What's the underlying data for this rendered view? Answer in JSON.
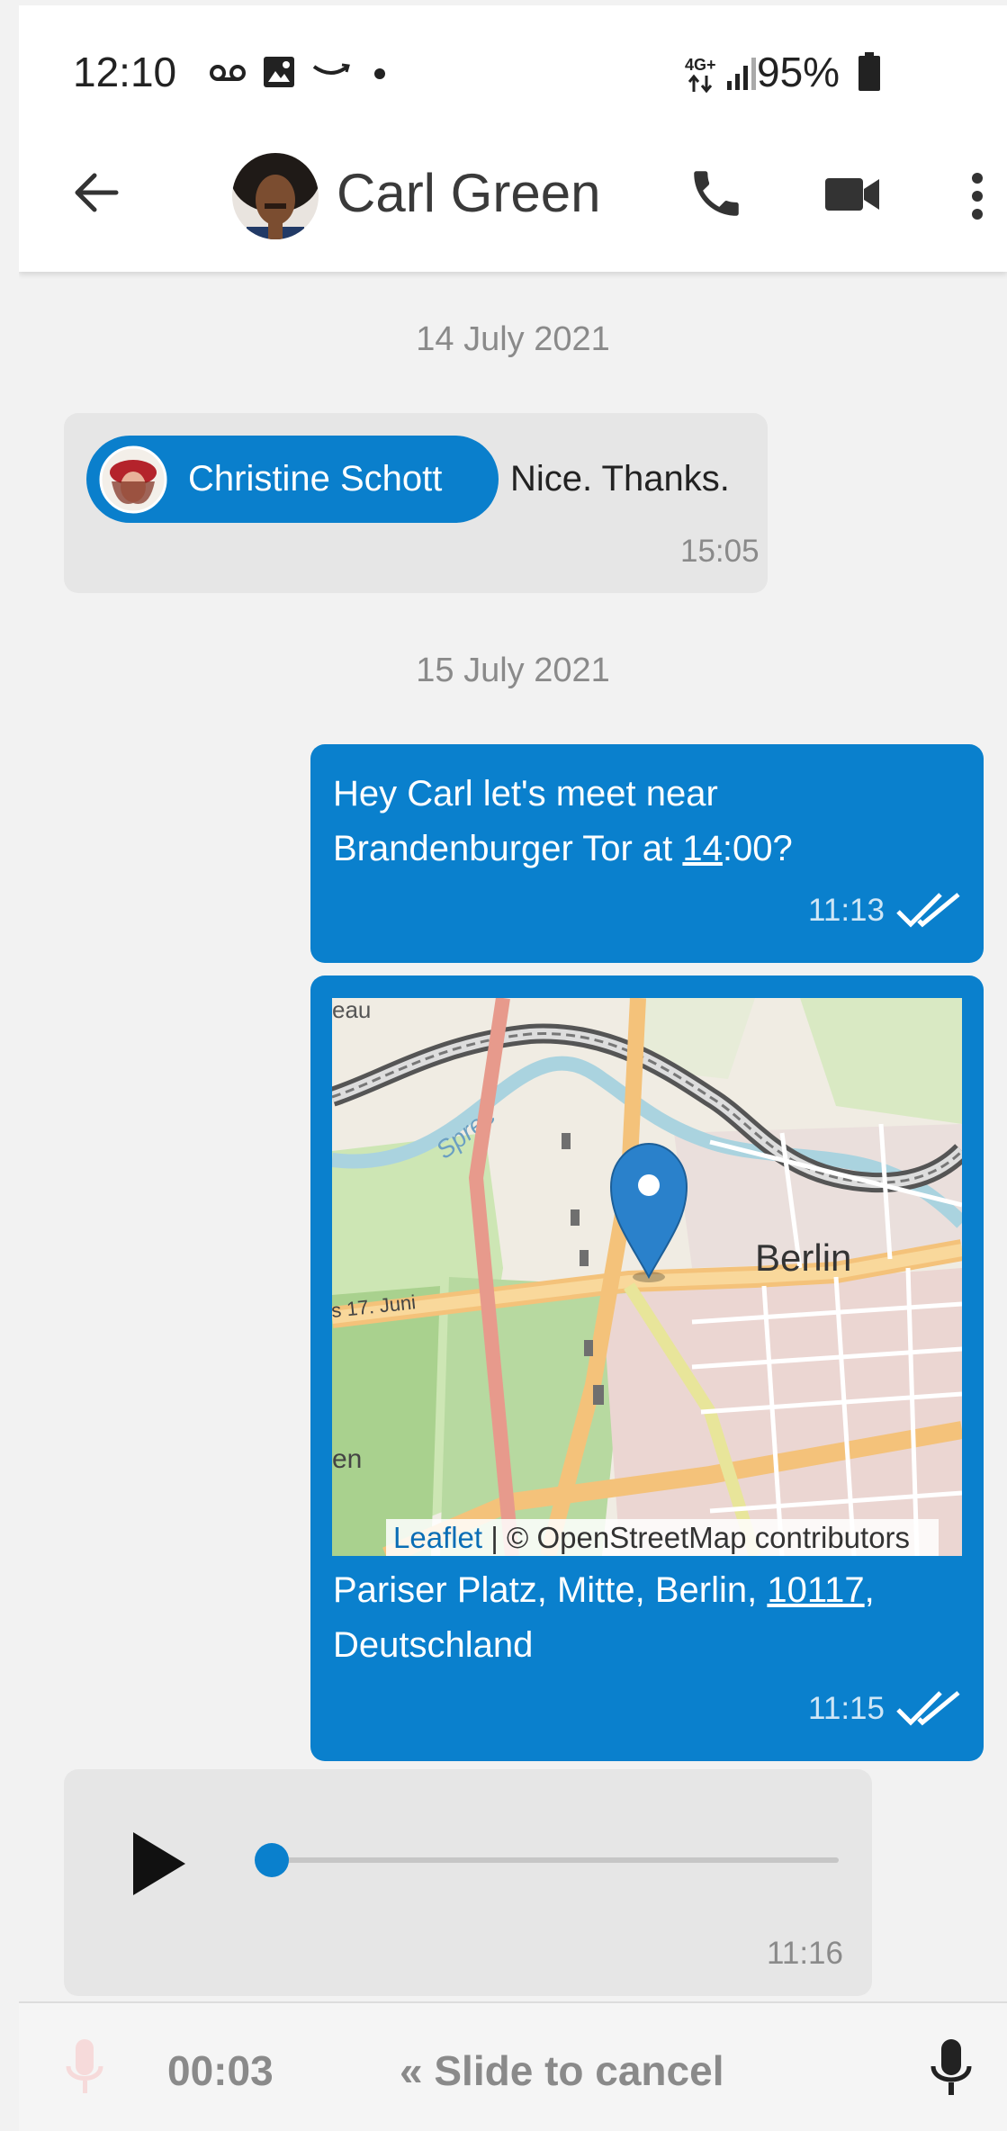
{
  "status_bar": {
    "time": "12:10",
    "network": "4G+",
    "battery": "95%"
  },
  "header": {
    "contact_name": "Carl Green",
    "icons": [
      "back-arrow-icon",
      "phone-icon",
      "video-camera-icon",
      "more-vert-icon"
    ]
  },
  "messages": {
    "date1": "14 July 2021",
    "m1": {
      "mention": "Christine Schott",
      "text": "Nice. Thanks.",
      "time": "15:05"
    },
    "date2": "15 July 2021",
    "m2": {
      "line1": "Hey Carl let's meet near",
      "line2_pre": "Brandenburger Tor at ",
      "line2_link": "14",
      "line2_post": ":00?",
      "time": "11:13"
    },
    "m3": {
      "map_label_city": "Berlin",
      "map_label_street": "s 17. Juni",
      "map_label_river": "Spree",
      "map_label_top": "eau",
      "map_label_left": "en",
      "attribution_link": "Leaflet",
      "attribution_rest": " | © OpenStreetMap contributors",
      "addr_pre": "Pariser Platz, Mitte, Berlin, ",
      "addr_link": "10117",
      "addr_post": ",",
      "addr_line2": "Deutschland",
      "time": "11:15"
    },
    "m4": {
      "type": "audio",
      "progress": 0,
      "time": "11:16"
    }
  },
  "composer": {
    "record_time": "00:03",
    "slide_hint": "« Slide to cancel"
  },
  "colors": {
    "accent": "#0a80cd",
    "incoming_bubble": "#e6e6e6",
    "background": "#f2f2f2"
  }
}
